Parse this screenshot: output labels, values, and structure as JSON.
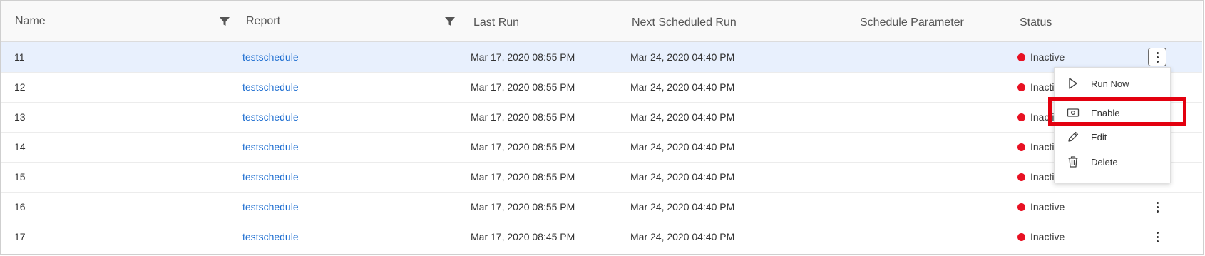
{
  "columns": {
    "name": "Name",
    "report": "Report",
    "last_run": "Last Run",
    "next_run": "Next Scheduled Run",
    "schedule_parameter": "Schedule Parameter",
    "status": "Status"
  },
  "icons": {
    "filter": "filter-icon",
    "kebab": "more-vertical-icon",
    "run_now": "play-icon",
    "enable": "enable-icon",
    "edit": "pencil-icon",
    "delete": "trash-icon"
  },
  "colors": {
    "link": "#1f6fd1",
    "status_inactive": "#e81123",
    "selected_row": "#e8f0fd",
    "highlight": "#e3000f"
  },
  "rows": [
    {
      "name": "11",
      "report": "testschedule",
      "last_run": "Mar 17, 2020 08:55 PM",
      "next_run": "Mar 24, 2020 04:40 PM",
      "schedule_parameter": "",
      "status": "Inactive"
    },
    {
      "name": "12",
      "report": "testschedule",
      "last_run": "Mar 17, 2020 08:55 PM",
      "next_run": "Mar 24, 2020 04:40 PM",
      "schedule_parameter": "",
      "status": "Inactive"
    },
    {
      "name": "13",
      "report": "testschedule",
      "last_run": "Mar 17, 2020 08:55 PM",
      "next_run": "Mar 24, 2020 04:40 PM",
      "schedule_parameter": "",
      "status": "Inactive"
    },
    {
      "name": "14",
      "report": "testschedule",
      "last_run": "Mar 17, 2020 08:55 PM",
      "next_run": "Mar 24, 2020 04:40 PM",
      "schedule_parameter": "",
      "status": "Inactive"
    },
    {
      "name": "15",
      "report": "testschedule",
      "last_run": "Mar 17, 2020 08:55 PM",
      "next_run": "Mar 24, 2020 04:40 PM",
      "schedule_parameter": "",
      "status": "Inactive"
    },
    {
      "name": "16",
      "report": "testschedule",
      "last_run": "Mar 17, 2020 08:55 PM",
      "next_run": "Mar 24, 2020 04:40 PM",
      "schedule_parameter": "",
      "status": "Inactive"
    },
    {
      "name": "17",
      "report": "testschedule",
      "last_run": "Mar 17, 2020 08:45 PM",
      "next_run": "Mar 24, 2020 04:40 PM",
      "schedule_parameter": "",
      "status": "Inactive"
    }
  ],
  "selected_row": 0,
  "context_menu": {
    "items": [
      {
        "label": "Run Now",
        "icon": "play-icon"
      },
      {
        "label": "Enable",
        "icon": "enable-icon",
        "highlighted": true
      },
      {
        "label": "Edit",
        "icon": "pencil-icon"
      },
      {
        "label": "Delete",
        "icon": "trash-icon"
      }
    ]
  }
}
